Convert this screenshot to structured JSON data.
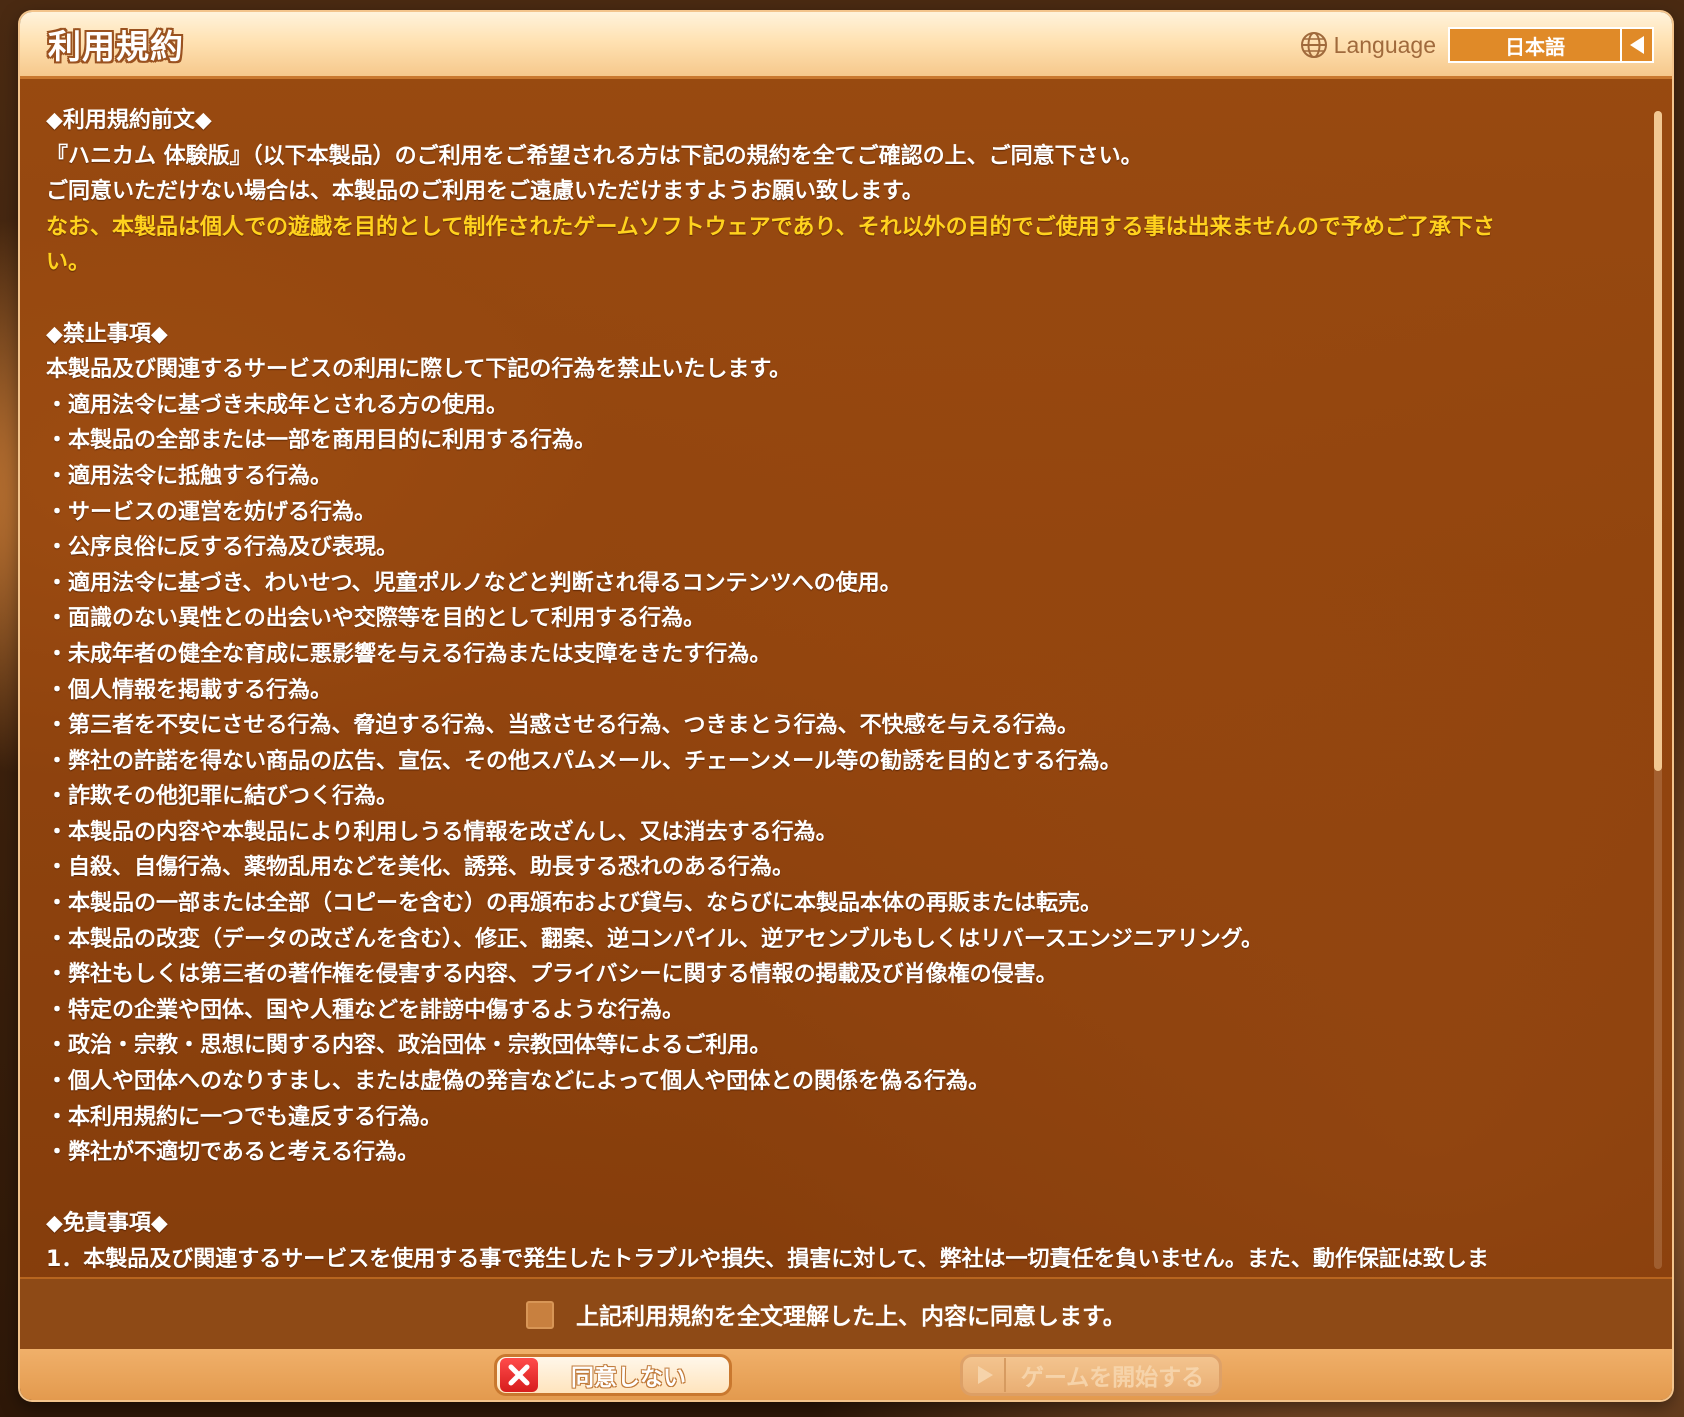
{
  "dialog": {
    "title": "利用規約",
    "language": {
      "label": "Language",
      "selected": "日本語"
    }
  },
  "terms": {
    "section1": {
      "heading": "◆利用規約前文◆",
      "line1": "『ハニカム 体験版』（以下本製品）のご利用をご希望される方は下記の規約を全てご確認の上、ご同意下さい。",
      "line2": "ご同意いただけない場合は、本製品のご利用をご遠慮いただけますようお願い致します。",
      "notice_line1": "なお、本製品は個人での遊戯を目的として制作されたゲームソフトウェアであり、それ以外の目的でご使用する事は出来ませんので予めご了承下さ",
      "notice_line2": "い。"
    },
    "section2": {
      "heading": "◆禁止事項◆",
      "intro": "本製品及び関連するサービスの利用に際して下記の行為を禁止いたします。",
      "items": [
        "・適用法令に基づき未成年とされる方の使用。",
        "・本製品の全部または一部を商用目的に利用する行為。",
        "・適用法令に抵触する行為。",
        "・サービスの運営を妨げる行為。",
        "・公序良俗に反する行為及び表現。",
        "・適用法令に基づき、わいせつ、児童ポルノなどと判断され得るコンテンツへの使用。",
        "・面識のない異性との出会いや交際等を目的として利用する行為。",
        "・未成年者の健全な育成に悪影響を与える行為または支障をきたす行為。",
        "・個人情報を掲載する行為。",
        "・第三者を不安にさせる行為、脅迫する行為、当惑させる行為、つきまとう行為、不快感を与える行為。",
        "・弊社の許諾を得ない商品の広告、宣伝、その他スパムメール、チェーンメール等の勧誘を目的とする行為。",
        "・詐欺その他犯罪に結びつく行為。",
        "・本製品の内容や本製品により利用しうる情報を改ざんし、又は消去する行為。",
        "・自殺、自傷行為、薬物乱用などを美化、誘発、助長する恐れのある行為。",
        "・本製品の一部または全部（コピーを含む）の再頒布および貸与、ならびに本製品本体の再販または転売。",
        "・本製品の改変（データの改ざんを含む）、修正、翻案、逆コンパイル、逆アセンブルもしくはリバースエンジニアリング。",
        "・弊社もしくは第三者の著作権を侵害する内容、プライバシーに関する情報の掲載及び肖像権の侵害。",
        "・特定の企業や団体、国や人種などを誹謗中傷するような行為。",
        "・政治・宗教・思想に関する内容、政治団体・宗教団体等によるご利用。",
        "・個人や団体へのなりすまし、または虚偽の発言などによって個人や団体との関係を偽る行為。",
        "・本利用規約に一つでも違反する行為。",
        "・弊社が不適切であると考える行為。"
      ]
    },
    "section3": {
      "heading": "◆免責事項◆",
      "line1": "1．本製品及び関連するサービスを使用する事で発生したトラブルや損失、損害に対して、弊社は一切責任を負いません。また、動作保証は致しま"
    }
  },
  "agreement": {
    "checked": false,
    "label": "上記利用規約を全文理解した上、内容に同意します。"
  },
  "buttons": {
    "disagree": "同意しない",
    "start": "ゲームを開始する"
  },
  "colors": {
    "accent_orange": "#e08a28",
    "notice_yellow": "#ffd21e",
    "panel_brown": "#9e4c10"
  }
}
